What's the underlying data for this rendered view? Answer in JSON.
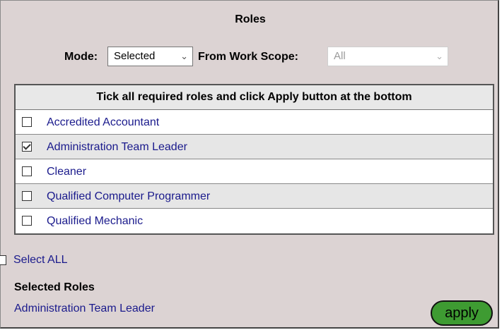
{
  "title": "Roles",
  "mode": {
    "label": "Mode:",
    "value": "Selected",
    "scope_label": "From Work Scope:",
    "scope_value": "All"
  },
  "table": {
    "header": "Tick all required roles and click Apply button at the bottom",
    "rows": [
      {
        "label": "Accredited Accountant",
        "checked": false
      },
      {
        "label": "Administration Team Leader",
        "checked": true
      },
      {
        "label": "Cleaner",
        "checked": false
      },
      {
        "label": "Qualified Computer Programmer",
        "checked": false
      },
      {
        "label": "Qualified Mechanic",
        "checked": false
      }
    ]
  },
  "select_all": {
    "label": "Select ALL",
    "checked": false
  },
  "selected_roles": {
    "title": "Selected Roles",
    "items": [
      "Administration Team Leader"
    ]
  },
  "apply_label": "apply",
  "colors": {
    "background": "#dcd3d3",
    "link": "#1a1a8c",
    "apply_button": "#3e9b32",
    "row_shade": "#e6e6e6"
  }
}
